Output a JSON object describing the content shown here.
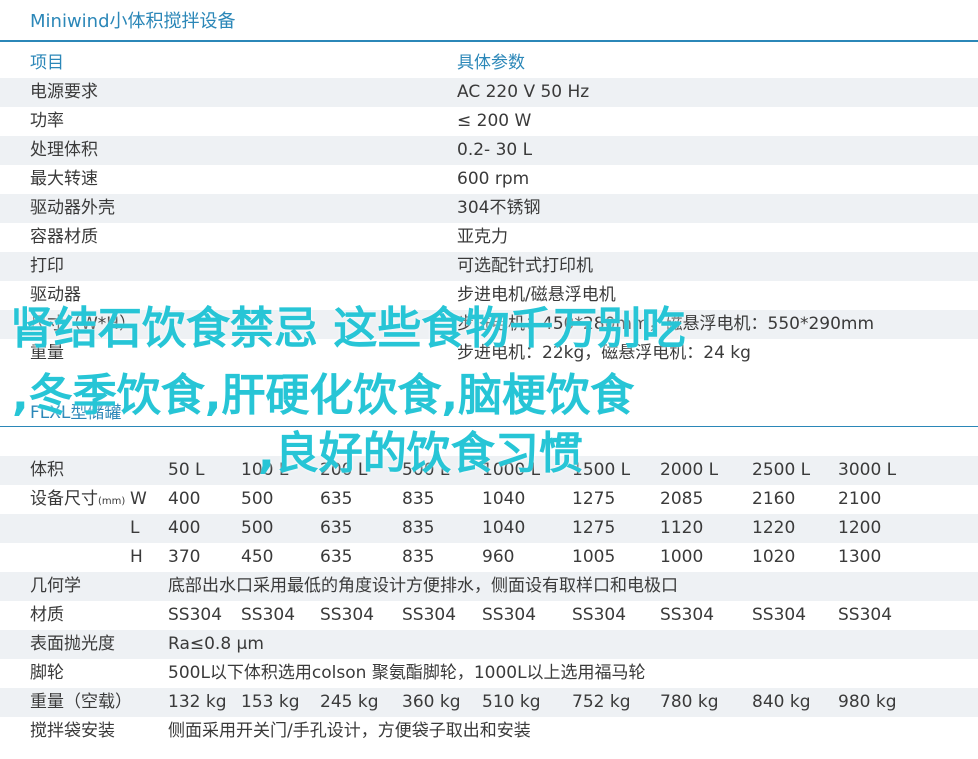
{
  "title": "Miniwind小体积搅拌设备",
  "spec_table": {
    "header": [
      "项目",
      "具体参数"
    ],
    "rows": [
      [
        "电源要求",
        "AC 220 V 50 Hz"
      ],
      [
        "功率",
        "≤ 200 W"
      ],
      [
        "处理体积",
        "0.2- 30 L"
      ],
      [
        "最大转速",
        "600 rpm"
      ],
      [
        "驱动器外壳",
        "304不锈钢"
      ],
      [
        "容器材质",
        "亚克力"
      ],
      [
        "打印",
        "可选配针式打印机"
      ],
      [
        "驱动器",
        "步进电机/磁悬浮电机"
      ],
      [
        "尺寸（W*H）",
        "步进电机：450*280mm，磁悬浮电机：550*290mm"
      ],
      [
        "重量",
        "步进电机：22kg，磁悬浮电机：24 kg"
      ]
    ]
  },
  "overlay": {
    "line1": "肾结石饮食禁忌 这些食物千万别吃",
    "line2": ",冬季饮食,肝硬化饮食,脑梗饮食",
    "line3": ",良好的饮食习惯"
  },
  "subsection_title": "FLXL型储罐",
  "tank_table": {
    "volume_label": "体积",
    "volumes": [
      "50 L",
      "100 L",
      "200 L",
      "500 L",
      "1000 L",
      "1500 L",
      "2000 L",
      "2500 L",
      "3000 L"
    ],
    "size_label": "设备尺寸",
    "size_unit": "(mm)",
    "axis_w": "W",
    "axis_l": "L",
    "axis_h": "H",
    "w_values": [
      "400",
      "500",
      "635",
      "835",
      "1040",
      "1275",
      "2085",
      "2160",
      "2100"
    ],
    "l_values": [
      "400",
      "500",
      "635",
      "835",
      "1040",
      "1275",
      "1120",
      "1220",
      "1200"
    ],
    "h_values": [
      "370",
      "450",
      "635",
      "835",
      "960",
      "1005",
      "1000",
      "1020",
      "1300"
    ],
    "geometry_label": "几何学",
    "geometry_value": "底部出水口采用最低的角度设计方便排水，侧面设有取样口和电极口",
    "material_label": "材质",
    "material_values": [
      "SS304",
      "SS304",
      "SS304",
      "SS304",
      "SS304",
      "SS304",
      "SS304",
      "SS304",
      "SS304"
    ],
    "polish_label": "表面抛光度",
    "polish_value": "Ra≤0.8 μm",
    "caster_label": "脚轮",
    "caster_value": "500L以下体积选用colson 聚氨酯脚轮，1000L以上选用福马轮",
    "weight_label": "重量（空载）",
    "weight_values": [
      "132 kg",
      "153 kg",
      "245 kg",
      "360 kg",
      "510 kg",
      "752 kg",
      "780 kg",
      "840 kg",
      "980 kg"
    ],
    "bag_label": "搅拌袋安装",
    "bag_value": "侧面采用开关门/手孔设计，方便袋子取出和安装"
  }
}
